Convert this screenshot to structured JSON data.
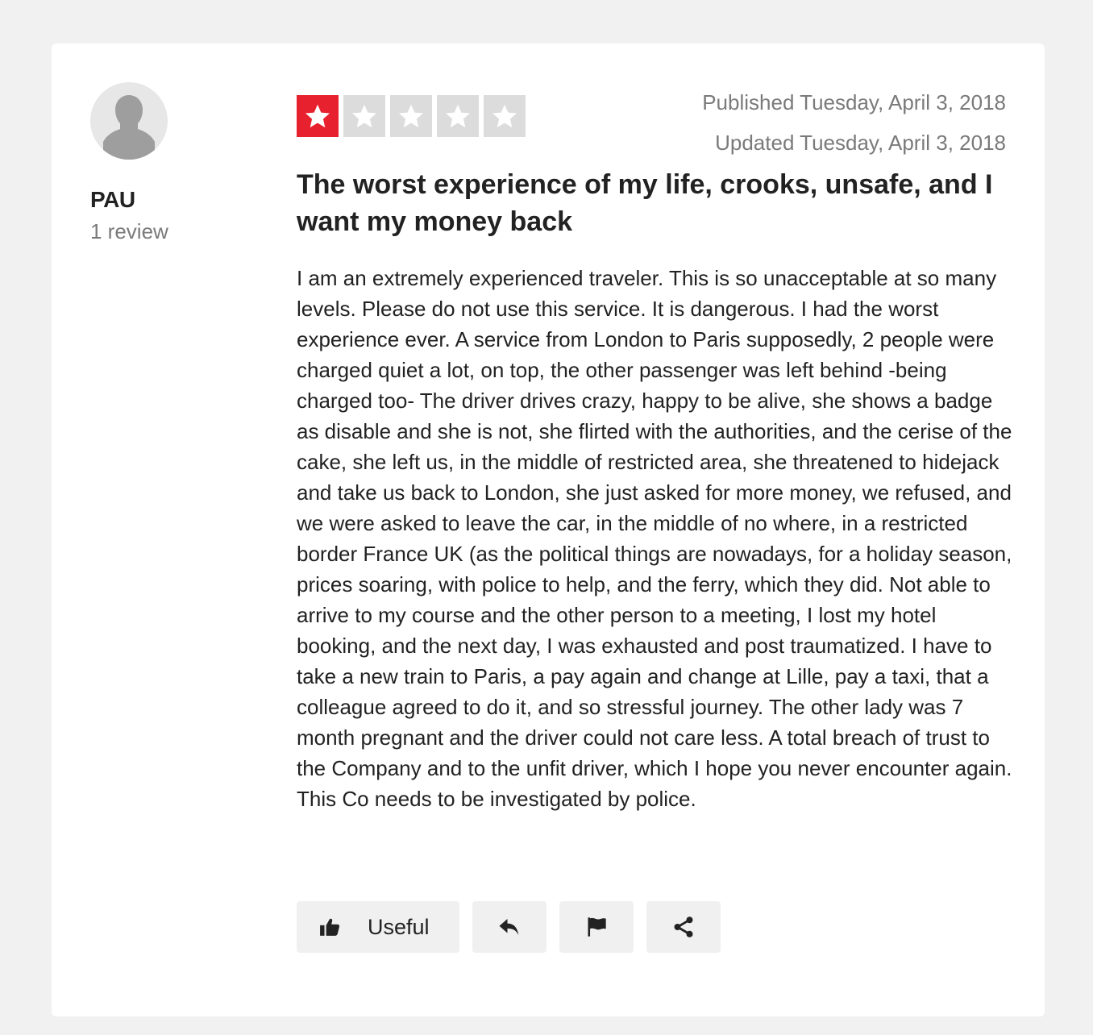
{
  "reviewer": {
    "name": "PAU",
    "review_count": "1 review",
    "avatar_icon": "user-silhouette-icon"
  },
  "rating": {
    "value": 1,
    "max": 5,
    "filled_color": "#e8212e",
    "empty_color": "#dcdcdc"
  },
  "dates": {
    "published": "Published Tuesday, April 3, 2018",
    "updated": "Updated Tuesday, April 3, 2018"
  },
  "review": {
    "title": "The worst experience of my life, crooks, unsafe, and I want my money back",
    "body": "I am an extremely experienced traveler. This is so unacceptable at so many levels. Please do not use this service. It is dangerous. I had the worst experience ever. A service from London to Paris supposedly, 2 people were charged quiet a lot, on top, the other passenger was left behind -being charged too- The driver drives crazy, happy to be alive, she shows a badge as disable and she is not, she flirted with the authorities, and the cerise of the cake, she left us, in the middle of restricted area, she threatened to hidejack and take us back to London, she just asked for more money, we refused, and we were asked to leave the car, in the middle of no where, in a restricted border France UK (as the political things are nowadays, for a holiday season, prices soaring, with police to help, and the ferry, which they did. Not able to arrive to my course and the other person to a meeting, I lost my hotel booking, and the next day, I was exhausted and post traumatized. I have to take a new train to Paris, a pay again and change at Lille, pay a taxi, that a colleague agreed to do it, and so stressful journey. The other lady was 7 month pregnant and the driver could not care less. A total breach of trust to the Company and to the unfit driver, which I hope you never encounter again. This Co needs to be investigated by police."
  },
  "actions": {
    "useful_label": "Useful",
    "useful_icon": "thumbs-up-icon",
    "reply_icon": "reply-icon",
    "flag_icon": "flag-icon",
    "share_icon": "share-icon"
  }
}
